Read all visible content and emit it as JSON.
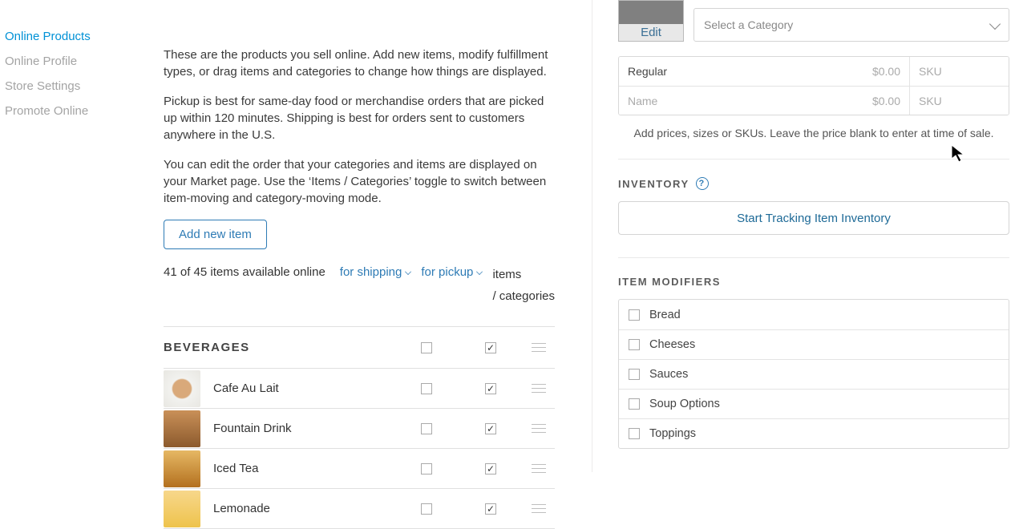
{
  "sidebar": {
    "items": [
      {
        "label": "Online Products",
        "active": true
      },
      {
        "label": "Online Profile"
      },
      {
        "label": "Store Settings"
      },
      {
        "label": "Promote Online"
      }
    ]
  },
  "main": {
    "para1": "These are the products you sell online. Add new items, modify fulfillment types, or drag items and categories to change how things are displayed.",
    "para2": "Pickup is best for same-day food or merchandise orders that are picked up within 120 minutes. Shipping is best for orders sent to customers anywhere in the U.S.",
    "para3": "You can edit the order that your categories and items are displayed on your Market page. Use the ‘Items / Categories’ toggle to switch between item-moving and category-moving mode.",
    "add_btn": "Add new item",
    "count_text": "41 of 45 items available online",
    "filter_shipping": "for shipping",
    "filter_pickup": "for pickup",
    "toggle_line1": "items",
    "toggle_line2": "/ categories",
    "category": "BEVERAGES",
    "items": [
      {
        "name": "Cafe Au Lait",
        "thumb": "coffee"
      },
      {
        "name": "Fountain Drink",
        "thumb": "fountain"
      },
      {
        "name": "Iced Tea",
        "thumb": "icedtea"
      },
      {
        "name": "Lemonade",
        "thumb": "lemonade"
      }
    ]
  },
  "right": {
    "edit_label": "Edit",
    "category_placeholder": "Select a Category",
    "variants": [
      {
        "name": "Regular",
        "price": "$0.00",
        "sku_ph": "SKU"
      },
      {
        "name_ph": "Name",
        "price": "$0.00",
        "sku_ph": "SKU"
      }
    ],
    "hint": "Add prices, sizes or SKUs. Leave the price blank to enter at time of sale.",
    "inventory_label": "INVENTORY",
    "track_btn": "Start Tracking Item Inventory",
    "modifiers_label": "ITEM MODIFIERS",
    "modifiers": [
      {
        "label": "Bread"
      },
      {
        "label": "Cheeses"
      },
      {
        "label": "Sauces"
      },
      {
        "label": "Soup Options"
      },
      {
        "label": "Toppings"
      }
    ]
  }
}
